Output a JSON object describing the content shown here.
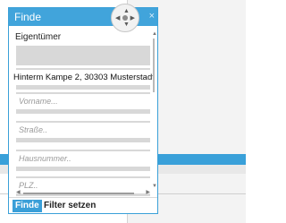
{
  "panel": {
    "title": "Finde",
    "close_glyph": "×",
    "owner_label": "Eigentümer",
    "address_value": "Hinterm Kampe 2, 30303 Musterstadt",
    "fields": [
      {
        "placeholder": "Vorname..."
      },
      {
        "placeholder": "Straße.."
      },
      {
        "placeholder": "Hausnummer.."
      },
      {
        "placeholder": "PLZ.."
      }
    ],
    "footer": {
      "find_label": "Finde",
      "filter_label": "Filter setzen"
    }
  },
  "icons": {
    "pan": "move-pan-icon",
    "scroll_up": "chevron-up-icon",
    "scroll_down": "chevron-down-icon",
    "scroll_left": "chevron-left-icon",
    "scroll_right": "chevron-right-icon"
  },
  "colors": {
    "accent": "#41a4db",
    "field_bg": "#d8d8d8",
    "placeholder": "#9a9a9a"
  }
}
